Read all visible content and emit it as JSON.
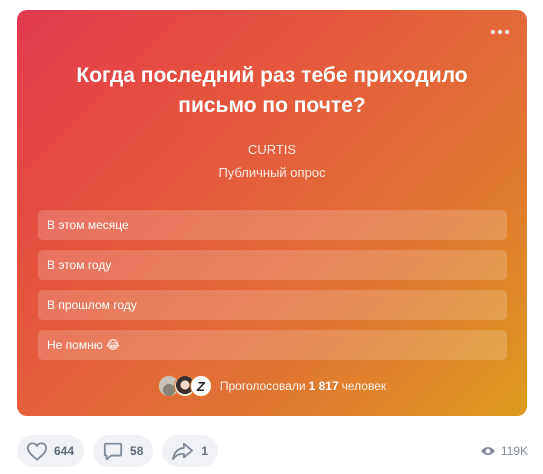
{
  "poll": {
    "question": "Когда последний раз тебе приходило письмо по почте?",
    "author": "CURTIS",
    "type": "Публичный опрос",
    "options": [
      {
        "label": "В этом месяце"
      },
      {
        "label": "В этом году"
      },
      {
        "label": "В прошлом году"
      },
      {
        "label": "Не помню 😂"
      }
    ],
    "voters_prefix": "Проголосовали",
    "voters_count": "1 817",
    "voters_suffix": "человек",
    "avatar3_letter": "Z"
  },
  "actions": {
    "likes": "644",
    "comments": "58",
    "shares": "1",
    "views": "119K"
  },
  "icons": {
    "more": "more-dots-icon",
    "like": "heart-icon",
    "comment": "comment-icon",
    "share": "share-arrow-icon",
    "views": "eye-icon"
  },
  "colors": {
    "gradient_start": "#e2394e",
    "gradient_end": "#dd9a1e",
    "action_text": "#5e6b7a",
    "action_bg": "#f0f2f5"
  }
}
